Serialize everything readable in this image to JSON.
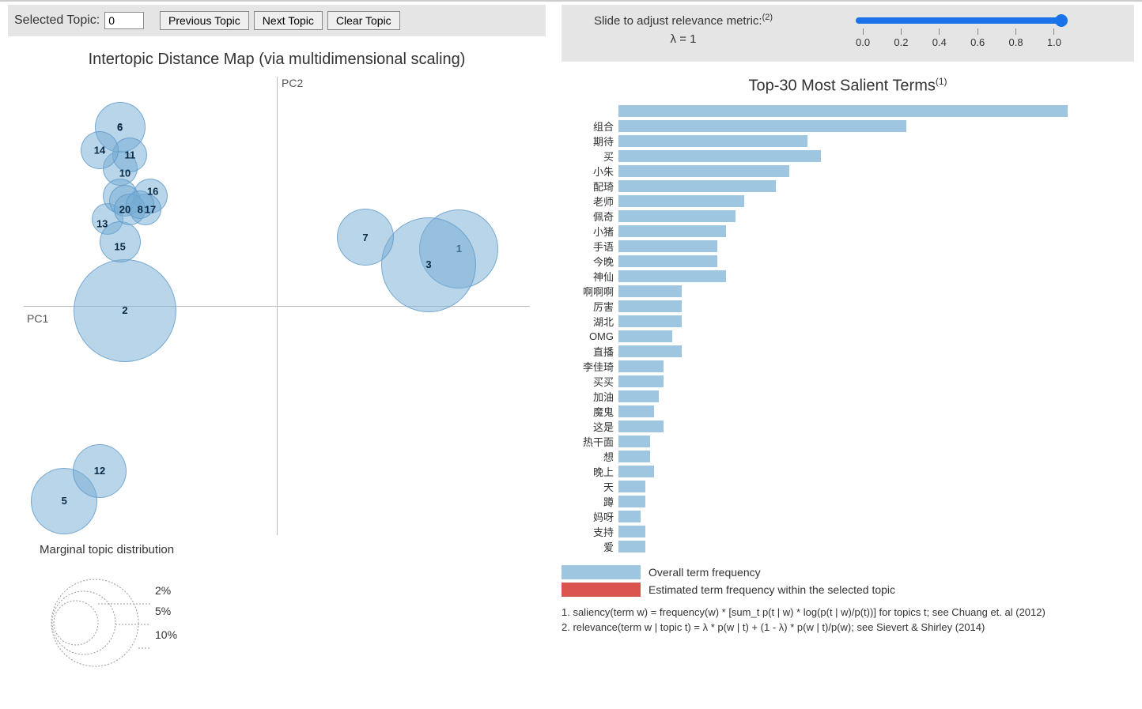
{
  "controls": {
    "selected_label": "Selected Topic:",
    "selected_value": "0",
    "prev_label": "Previous Topic",
    "next_label": "Next Topic",
    "clear_label": "Clear Topic"
  },
  "slider": {
    "label_line1": "Slide to adjust relevance metric:",
    "label_sup": "(2)",
    "lambda_label": "λ = 1",
    "ticks": [
      "0.0",
      "0.2",
      "0.4",
      "0.6",
      "0.8",
      "1.0"
    ],
    "value": 1.0
  },
  "left_title": "Intertopic Distance Map (via multidimensional scaling)",
  "axis_pc1": "PC1",
  "axis_pc2": "PC2",
  "marginal_title": "Marginal topic distribution",
  "marginal_pcts": [
    "2%",
    "5%",
    "10%"
  ],
  "right_title_main": "Top-30 Most Salient Terms",
  "right_title_sup": "(1)",
  "legend_overall": "Overall term frequency",
  "legend_within": "Estimated term frequency within the selected topic",
  "footnote1": "1. saliency(term w) = frequency(w) * [sum_t p(t | w) * log(p(t | w)/p(t))] for topics t; see Chuang et. al (2012)",
  "footnote2": "2. relevance(term w | topic t) = λ * p(w | t) + (1 - λ) * p(w | t)/p(w); see Sievert & Shirley (2014)",
  "chart_data": {
    "mds": {
      "type": "scatter",
      "xlabel": "PC1",
      "ylabel": "PC2",
      "bubbles": [
        {
          "id": "1",
          "x": 0.72,
          "y": 0.25,
          "r": 50
        },
        {
          "id": "2",
          "x": -0.6,
          "y": -0.02,
          "r": 65
        },
        {
          "id": "3",
          "x": 0.6,
          "y": 0.18,
          "r": 60
        },
        {
          "id": "5",
          "x": -0.84,
          "y": -0.85,
          "r": 42
        },
        {
          "id": "6",
          "x": -0.62,
          "y": 0.78,
          "r": 32
        },
        {
          "id": "7",
          "x": 0.35,
          "y": 0.3,
          "r": 36
        },
        {
          "id": "10",
          "x": -0.62,
          "y": 0.6,
          "r": 22
        },
        {
          "id": "11",
          "x": -0.58,
          "y": 0.66,
          "r": 22
        },
        {
          "id": "12",
          "x": -0.7,
          "y": -0.72,
          "r": 34
        },
        {
          "id": "13",
          "x": -0.67,
          "y": 0.38,
          "r": 20
        },
        {
          "id": "14",
          "x": -0.7,
          "y": 0.68,
          "r": 24
        },
        {
          "id": "15",
          "x": -0.62,
          "y": 0.28,
          "r": 26
        },
        {
          "id": "16",
          "x": -0.5,
          "y": 0.48,
          "r": 22
        },
        {
          "id": "17",
          "x": -0.52,
          "y": 0.42,
          "r": 20
        },
        {
          "id": "18",
          "x": -0.62,
          "y": 0.48,
          "r": 22
        },
        {
          "id": "19",
          "x": -0.6,
          "y": 0.46,
          "r": 20
        },
        {
          "id": "20",
          "x": -0.58,
          "y": 0.42,
          "r": 20
        },
        {
          "id": "8",
          "x": -0.54,
          "y": 0.44,
          "r": 18
        }
      ],
      "extra_labels": [
        {
          "text": "6",
          "x": -0.62,
          "y": 0.78
        },
        {
          "text": "14",
          "x": -0.7,
          "y": 0.68
        },
        {
          "text": "11",
          "x": -0.58,
          "y": 0.66
        },
        {
          "text": "10",
          "x": -0.6,
          "y": 0.58
        },
        {
          "text": "16",
          "x": -0.49,
          "y": 0.5
        },
        {
          "text": "17",
          "x": -0.5,
          "y": 0.42
        },
        {
          "text": "13",
          "x": -0.69,
          "y": 0.36
        },
        {
          "text": "20",
          "x": -0.6,
          "y": 0.42
        },
        {
          "text": "8",
          "x": -0.54,
          "y": 0.42
        },
        {
          "text": "15",
          "x": -0.62,
          "y": 0.26
        }
      ]
    },
    "bars": {
      "type": "bar",
      "title": "Top-30 Most Salient Terms",
      "xlabel": "",
      "ylabel": "",
      "max": 100,
      "series": [
        {
          "name": "Overall term frequency",
          "terms": [
            {
              "term": "",
              "value": 100
            },
            {
              "term": "组合",
              "value": 64
            },
            {
              "term": "期待",
              "value": 42
            },
            {
              "term": "买",
              "value": 45
            },
            {
              "term": "小朱",
              "value": 38
            },
            {
              "term": "配琦",
              "value": 35
            },
            {
              "term": "老师",
              "value": 28
            },
            {
              "term": "佩奇",
              "value": 26
            },
            {
              "term": "小猪",
              "value": 24
            },
            {
              "term": "手语",
              "value": 22
            },
            {
              "term": "今晚",
              "value": 22
            },
            {
              "term": "神仙",
              "value": 24
            },
            {
              "term": "啊啊啊",
              "value": 14
            },
            {
              "term": "厉害",
              "value": 14
            },
            {
              "term": "湖北",
              "value": 14
            },
            {
              "term": "OMG",
              "value": 12
            },
            {
              "term": "直播",
              "value": 14
            },
            {
              "term": "李佳琦",
              "value": 10
            },
            {
              "term": "买买",
              "value": 10
            },
            {
              "term": "加油",
              "value": 9
            },
            {
              "term": "魔鬼",
              "value": 8
            },
            {
              "term": "这是",
              "value": 10
            },
            {
              "term": "热干面",
              "value": 7
            },
            {
              "term": "想",
              "value": 7
            },
            {
              "term": "晚上",
              "value": 8
            },
            {
              "term": "天",
              "value": 6
            },
            {
              "term": "蹲",
              "value": 6
            },
            {
              "term": "妈呀",
              "value": 5
            },
            {
              "term": "支持",
              "value": 6
            },
            {
              "term": "爱",
              "value": 6
            }
          ]
        }
      ]
    }
  }
}
